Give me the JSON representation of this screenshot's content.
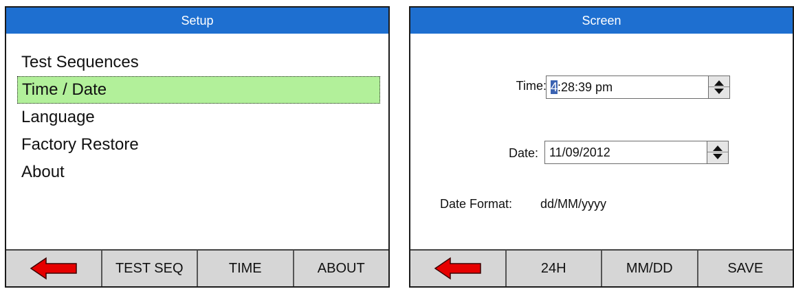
{
  "setup_screen": {
    "title": "Setup",
    "menu": [
      {
        "label": "Test Sequences"
      },
      {
        "label": "Time / Date"
      },
      {
        "label": "Language"
      },
      {
        "label": "Factory Restore"
      },
      {
        "label": "About"
      }
    ],
    "selected_index": 1,
    "buttons": {
      "back_icon": "red-left-arrow",
      "test_seq": "TEST SEQ",
      "time": "TIME",
      "about": "ABOUT"
    }
  },
  "time_date_screen": {
    "title": "Screen",
    "time_label": "Time:",
    "time_cursor_char": "4",
    "time_rest": ":28:39 pm",
    "date_label": "Date:",
    "date_value": "11/09/2012",
    "date_format_label": "Date Format:",
    "date_format_value": "dd/MM/yyyy",
    "buttons": {
      "back_icon": "red-left-arrow",
      "hour_format": "24H",
      "date_order": "MM/DD",
      "save": "SAVE"
    }
  },
  "colors": {
    "titlebar": "#1e6fd0",
    "selection": "#b2f09a",
    "back_arrow": "#e60000",
    "button_bg": "#d6d6d6"
  }
}
